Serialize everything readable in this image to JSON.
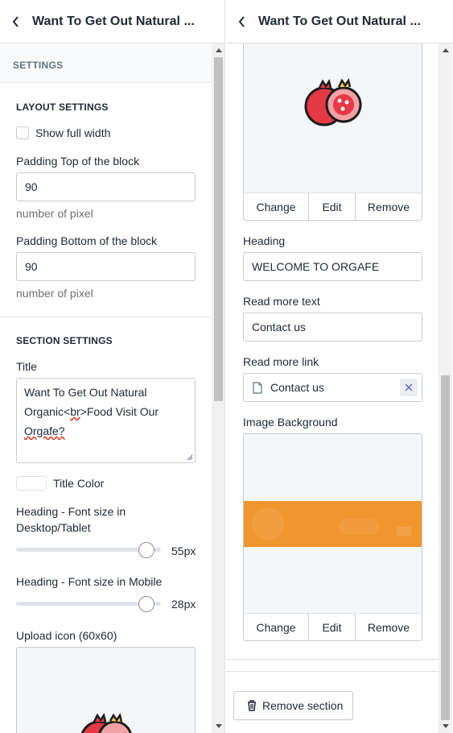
{
  "header": {
    "title": "Want To Get Out Natural ..."
  },
  "left": {
    "settings_heading": "SETTINGS",
    "layout_heading": "LAYOUT SETTINGS",
    "show_full_width": "Show full width",
    "pad_top_label": "Padding Top of the block",
    "pad_top_value": "90",
    "pad_top_help": "number of pixel",
    "pad_bottom_label": "Padding Bottom of the block",
    "pad_bottom_value": "90",
    "pad_bottom_help": "number of pixel",
    "section_heading": "SECTION SETTINGS",
    "title_label": "Title",
    "title_line1": "Want To Get Out Natural",
    "title_line2a": "Organic<",
    "title_line2_br": "br",
    "title_line2b": ">Food Visit Our",
    "title_line3": "Orgafe?",
    "title_color_label": "Title Color",
    "font_desktop_label_1": "Heading - Font size in",
    "font_desktop_label_2": "Desktop/Tablet",
    "font_desktop_value": "55px",
    "font_mobile_label": "Heading - Font size in Mobile",
    "font_mobile_value": "28px",
    "upload_icon_label": "Upload icon (60x60)"
  },
  "right": {
    "change": "Change",
    "edit": "Edit",
    "remove": "Remove",
    "heading_label": "Heading",
    "heading_value": "WELCOME TO ORGAFE",
    "read_more_label": "Read more text",
    "read_more_value": "Contact us",
    "read_more_link_label": "Read more link",
    "read_more_link_value": "Contact us",
    "image_bg_label": "Image Background",
    "change2": "Change",
    "edit2": "Edit",
    "remove2": "Remove",
    "remove_section": "Remove section"
  },
  "colors": {
    "banner_orange": "#f0962f",
    "pomegranate_red": "#e63946"
  },
  "sliders": {
    "desktop_fraction": 0.9,
    "mobile_fraction": 0.9
  }
}
